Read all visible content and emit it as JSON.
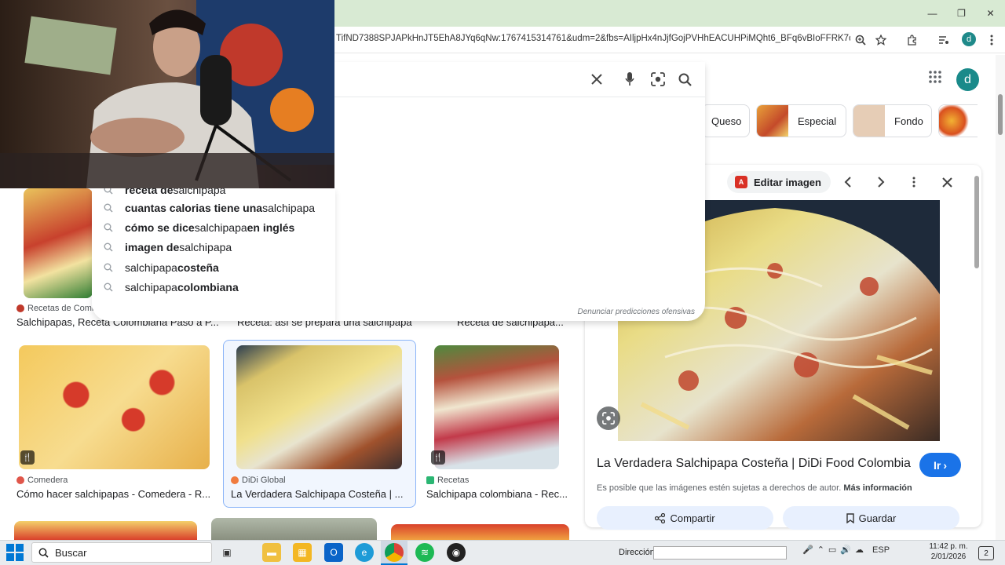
{
  "window": {
    "minimize_glyph": "—",
    "maximize_glyph": "❐",
    "close_glyph": "✕"
  },
  "browser": {
    "address": "TifND7388SPJAPkHnJT5EhA8JYq6qNw:1767415314761&udm=2&fbs=AIljpHx4nJjfGojPVHhEACUHPiMQht6_BFq6vBIoFFRK7qchKPz...",
    "profile_initial": "d",
    "icons": [
      "zoom-icon",
      "star-icon",
      "extensions-icon",
      "media-icon",
      "profile-icon",
      "menu-icon"
    ]
  },
  "search": {
    "suggestions": [
      {
        "bold1": "receta de",
        "normal": " salchipapa",
        "bold2": ""
      },
      {
        "bold1": "cuantas calorias tiene una",
        "normal": " salchipapa",
        "bold2": ""
      },
      {
        "bold1": "cómo se dice",
        "normal": " salchipapa ",
        "bold2": "en inglés"
      },
      {
        "bold1": "imagen de",
        "normal": " salchipapa",
        "bold2": ""
      },
      {
        "bold1": "",
        "normal": "salchipapa ",
        "bold2": "costeña"
      },
      {
        "bold1": "",
        "normal": "salchipapa ",
        "bold2": "colombiana"
      }
    ],
    "report_text": "Denunciar predicciones ofensivas"
  },
  "account": {
    "avatar_initial": "d"
  },
  "chips": [
    {
      "label": "Queso"
    },
    {
      "label": "Especial"
    },
    {
      "label": "Fondo"
    }
  ],
  "results_row1": [
    {
      "source": "Recetas de Comi",
      "title": "Salchipapas, Receta Colombiana Paso a P..."
    },
    {
      "source": "",
      "title": "Receta: así se prepara una salchipapa"
    },
    {
      "source": "",
      "title": "Receta de salchipapa..."
    }
  ],
  "results_row2": [
    {
      "source": "Comedera",
      "title": "Cómo hacer salchipapas - Comedera - R...",
      "fav_color": "#e0564a"
    },
    {
      "source": "DiDi Global",
      "title": "La Verdadera Salchipapa Costeña | ...",
      "fav_color": "#f07b3f"
    },
    {
      "source": "Recetas",
      "title": "Salchipapa colombiana - Rec...",
      "fav_color": "#2bb673"
    }
  ],
  "panel": {
    "edit_label": "Editar imagen",
    "title": "La Verdadera Salchipapa Costeña | DiDi Food Colombia",
    "go_label": "Ir",
    "copyright": "Es posible que las imágenes estén sujetas a derechos de autor.",
    "more_info": "Más información",
    "share_label": "Compartir",
    "save_label": "Guardar"
  },
  "taskbar": {
    "search_label": "Buscar",
    "address_label": "Dirección",
    "language": "ESP",
    "time": "11:42 p. m.",
    "date": "2/01/2026",
    "notification_count": "2"
  },
  "colors": {
    "accent_blue": "#1a73e8",
    "chrome_green": "#d8ead3",
    "selected_border": "#8ab4f8"
  }
}
